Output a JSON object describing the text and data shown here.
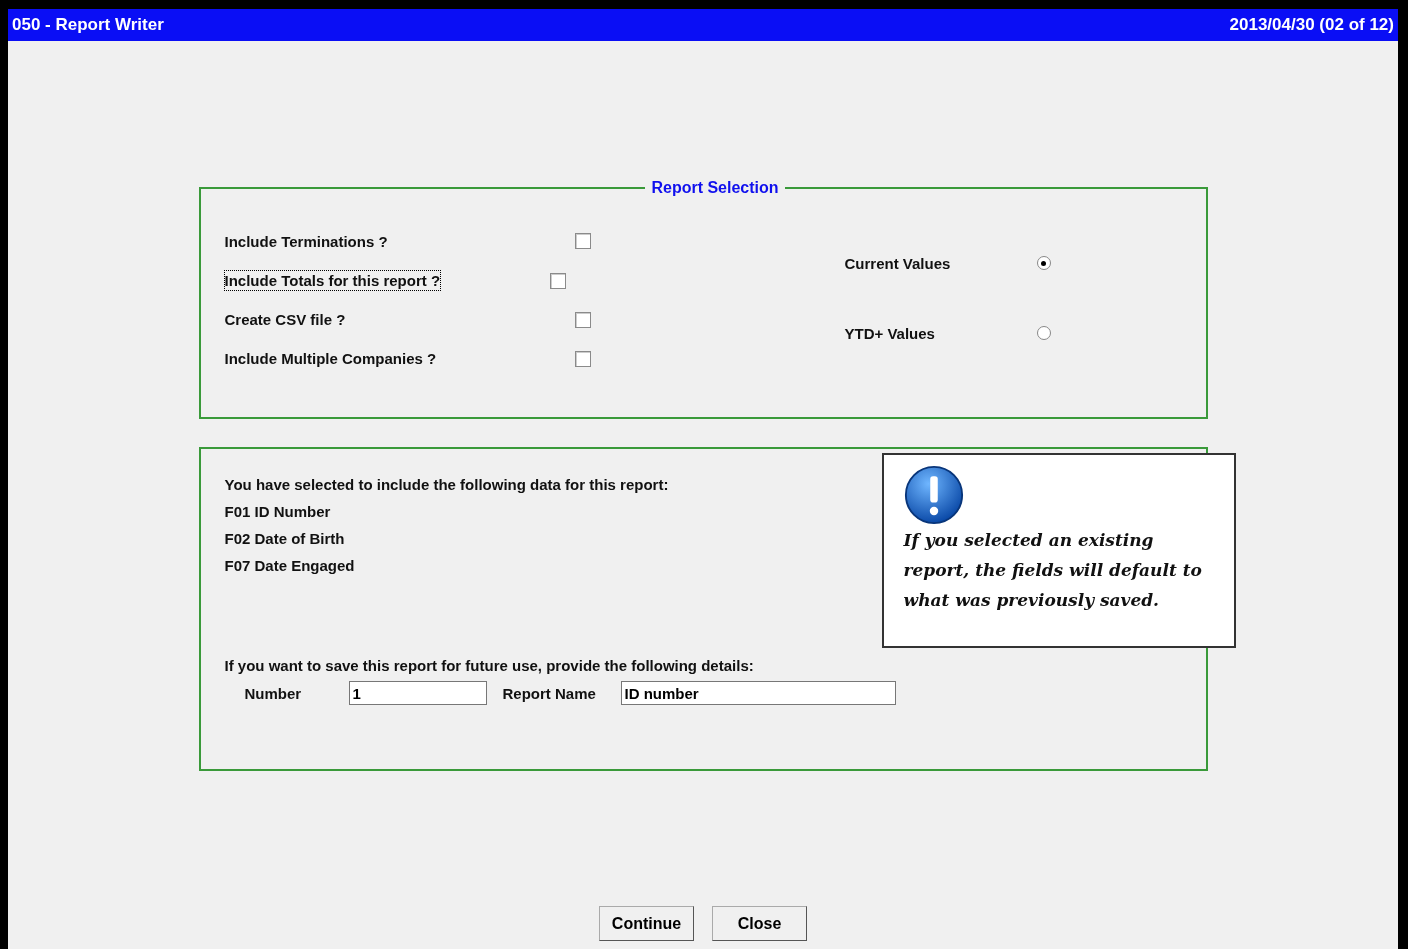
{
  "window": {
    "title": "050 - Report Writer",
    "period": "2013/04/30 (02 of 12)"
  },
  "report_selection": {
    "title": "Report Selection",
    "options": [
      {
        "label": "Include Terminations ?",
        "checked": false,
        "focused": false
      },
      {
        "label": "Include Totals for this report ?",
        "checked": false,
        "focused": true
      },
      {
        "label": "Create CSV file ?",
        "checked": false,
        "focused": false
      },
      {
        "label": "Include Multiple Companies ?",
        "checked": false,
        "focused": false
      }
    ],
    "values": [
      {
        "label": "Current Values",
        "selected": true
      },
      {
        "label": "YTD+ Values",
        "selected": false
      }
    ]
  },
  "details": {
    "intro": "You have selected to include the following data for this report:",
    "fields": [
      "F01 ID Number",
      "F02 Date of Birth",
      "F07 Date Engaged"
    ],
    "save_prompt": "If you want to save this report for future use, provide the following details:",
    "number": {
      "label": "Number",
      "value": "1"
    },
    "report_name": {
      "label": "Report Name",
      "value": "ID number"
    }
  },
  "callout": {
    "text": "If you selected an existing report, the fields will default to what was previously saved."
  },
  "buttons": [
    "Continue",
    "Close"
  ]
}
